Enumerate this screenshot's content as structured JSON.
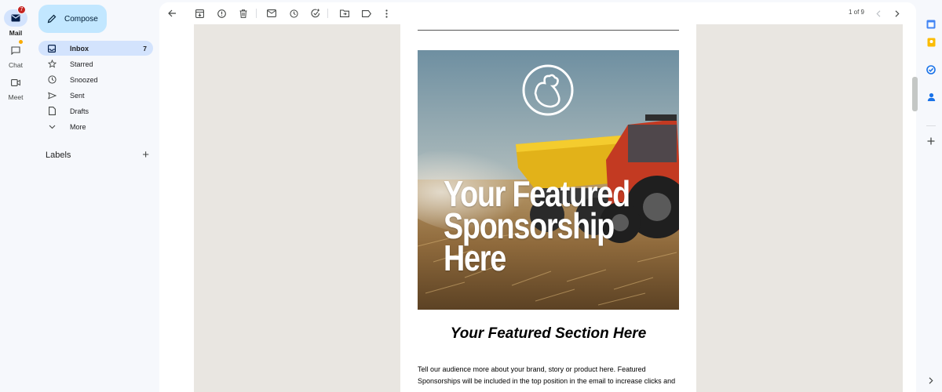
{
  "rail": {
    "mail": {
      "label": "Mail",
      "badge": "7"
    },
    "chat": {
      "label": "Chat"
    },
    "meet": {
      "label": "Meet"
    }
  },
  "sidebar": {
    "compose_label": "Compose",
    "items": [
      {
        "label": "Inbox",
        "count": "7",
        "icon": "inbox-icon"
      },
      {
        "label": "Starred",
        "icon": "star-icon"
      },
      {
        "label": "Snoozed",
        "icon": "clock-icon"
      },
      {
        "label": "Sent",
        "icon": "send-icon"
      },
      {
        "label": "Drafts",
        "icon": "draft-icon"
      },
      {
        "label": "More",
        "icon": "chevron-down-icon"
      }
    ],
    "labels_heading": "Labels"
  },
  "toolbar": {
    "pager": "1 of 9"
  },
  "email": {
    "hero_text": "Your Featured Sponsorship Here",
    "section_title": "Your Featured Section Here",
    "body": "Tell our audience more about your brand, story or product here. Featured Sponsorships will be included in the top position in the email to increase clicks and"
  },
  "colors": {
    "accent": "#c2e7ff",
    "active_nav": "#d3e3fd",
    "badge": "#c5221f",
    "viewer_bg": "#e9e6e1"
  }
}
